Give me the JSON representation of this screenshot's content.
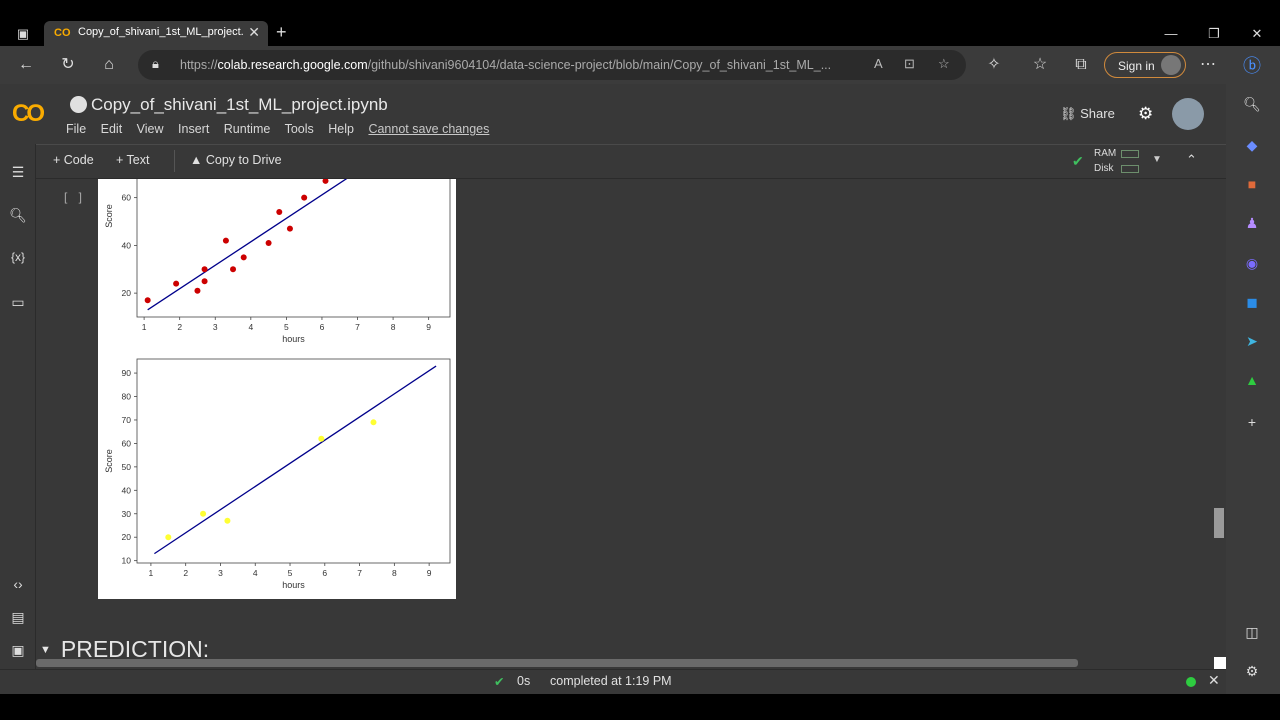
{
  "browser": {
    "tab_title": "Copy_of_shivani_1st_ML_project.",
    "tab_favicon": "CO",
    "url_host_prefix": "https://",
    "url_host": "colab.research.google.com",
    "url_path": "/github/shivani9604104/data-science-project/blob/main/Copy_of_shivani_1st_ML_...",
    "signin_label": "Sign in"
  },
  "colab": {
    "logo": "CO",
    "notebook_title": "Copy_of_shivani_1st_ML_project.ipynb",
    "menu": [
      "File",
      "Edit",
      "View",
      "Insert",
      "Runtime",
      "Tools",
      "Help"
    ],
    "menu_warning": "Cannot save changes",
    "share_label": "Share",
    "toolbar": {
      "add_code": "+ Code",
      "add_text": "+ Text",
      "copy_to_drive": "Copy to Drive",
      "ram_label": "RAM",
      "disk_label": "Disk"
    },
    "cell_bracket": "[ ]",
    "section_heading": "PREDICTION:",
    "status": {
      "duration": "0s",
      "completed": "completed at 1:19 PM"
    }
  },
  "icons": {
    "back": "arrow-left-icon",
    "refresh": "refresh-icon",
    "home": "home-icon",
    "lock": "lock-icon"
  },
  "chart_data": [
    {
      "type": "scatter",
      "title": "",
      "xlabel": "hours",
      "ylabel": "Score",
      "xlim": [
        0.8,
        9.6
      ],
      "ylim": [
        10,
        72
      ],
      "xticks": [
        1,
        2,
        3,
        4,
        5,
        6,
        7,
        8,
        9
      ],
      "yticks": [
        20,
        40,
        60
      ],
      "point_color": "#cc0000",
      "line_color": "#00008b",
      "points": [
        [
          1.1,
          17
        ],
        [
          1.9,
          24
        ],
        [
          2.5,
          21
        ],
        [
          2.7,
          25
        ],
        [
          2.7,
          30
        ],
        [
          3.3,
          42
        ],
        [
          3.5,
          30
        ],
        [
          3.8,
          35
        ],
        [
          4.5,
          41
        ],
        [
          4.8,
          54
        ],
        [
          5.1,
          47
        ],
        [
          5.5,
          60
        ],
        [
          6.1,
          67
        ]
      ],
      "fit_line": [
        [
          1.1,
          13
        ],
        [
          6.9,
          70
        ]
      ]
    },
    {
      "type": "scatter",
      "title": "",
      "xlabel": "hours",
      "ylabel": "Score",
      "xlim": [
        0.6,
        9.6
      ],
      "ylim": [
        9,
        96
      ],
      "xticks": [
        1,
        2,
        3,
        4,
        5,
        6,
        7,
        8,
        9
      ],
      "yticks": [
        10,
        20,
        30,
        40,
        50,
        60,
        70,
        80,
        90
      ],
      "point_color": "#ffff33",
      "line_color": "#00008b",
      "points": [
        [
          1.5,
          20
        ],
        [
          2.5,
          30
        ],
        [
          3.2,
          27
        ],
        [
          5.9,
          62
        ],
        [
          7.4,
          69
        ]
      ],
      "fit_line": [
        [
          1.1,
          13
        ],
        [
          9.2,
          93
        ]
      ]
    }
  ]
}
